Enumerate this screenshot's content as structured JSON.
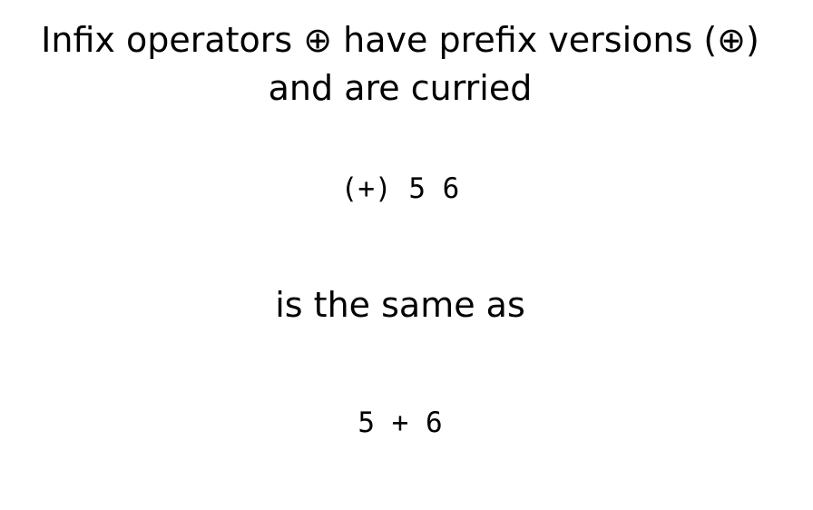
{
  "slide": {
    "title_lines": [
      "Infix operators ⊕ have prefix versions (⊕)",
      "and are curried"
    ],
    "prefix_example": "(+) 5 6",
    "middle_text": "is the same as",
    "infix_example": "5 + 6"
  }
}
